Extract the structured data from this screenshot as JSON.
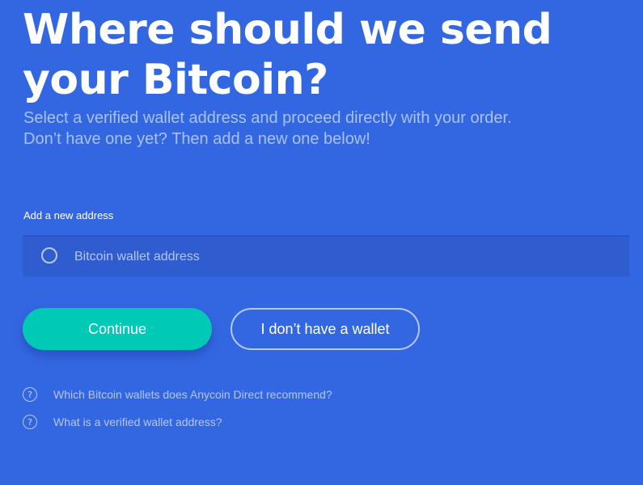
{
  "heading": {
    "title": "Where should we send your Bitcoin?",
    "subtitle_line1": "Select a verified wallet address and proceed directly with your order.",
    "subtitle_line2": "Don’t have one yet? Then add a new one below!"
  },
  "address_form": {
    "label": "Add a new address",
    "placeholder": "Bitcoin wallet address",
    "value": ""
  },
  "actions": {
    "continue_label": "Continue",
    "no_wallet_label": "I don’t have a wallet"
  },
  "help": {
    "items": [
      {
        "icon": "question-circle-icon",
        "label": "Which Bitcoin wallets does Anycoin Direct recommend?"
      },
      {
        "icon": "question-circle-icon",
        "label": "What is a verified wallet address?"
      }
    ]
  },
  "colors": {
    "background": "#3367e2",
    "field_background": "#2f5ccf",
    "primary_button": "#00c9b5",
    "muted_text": "#a9c1f5"
  }
}
